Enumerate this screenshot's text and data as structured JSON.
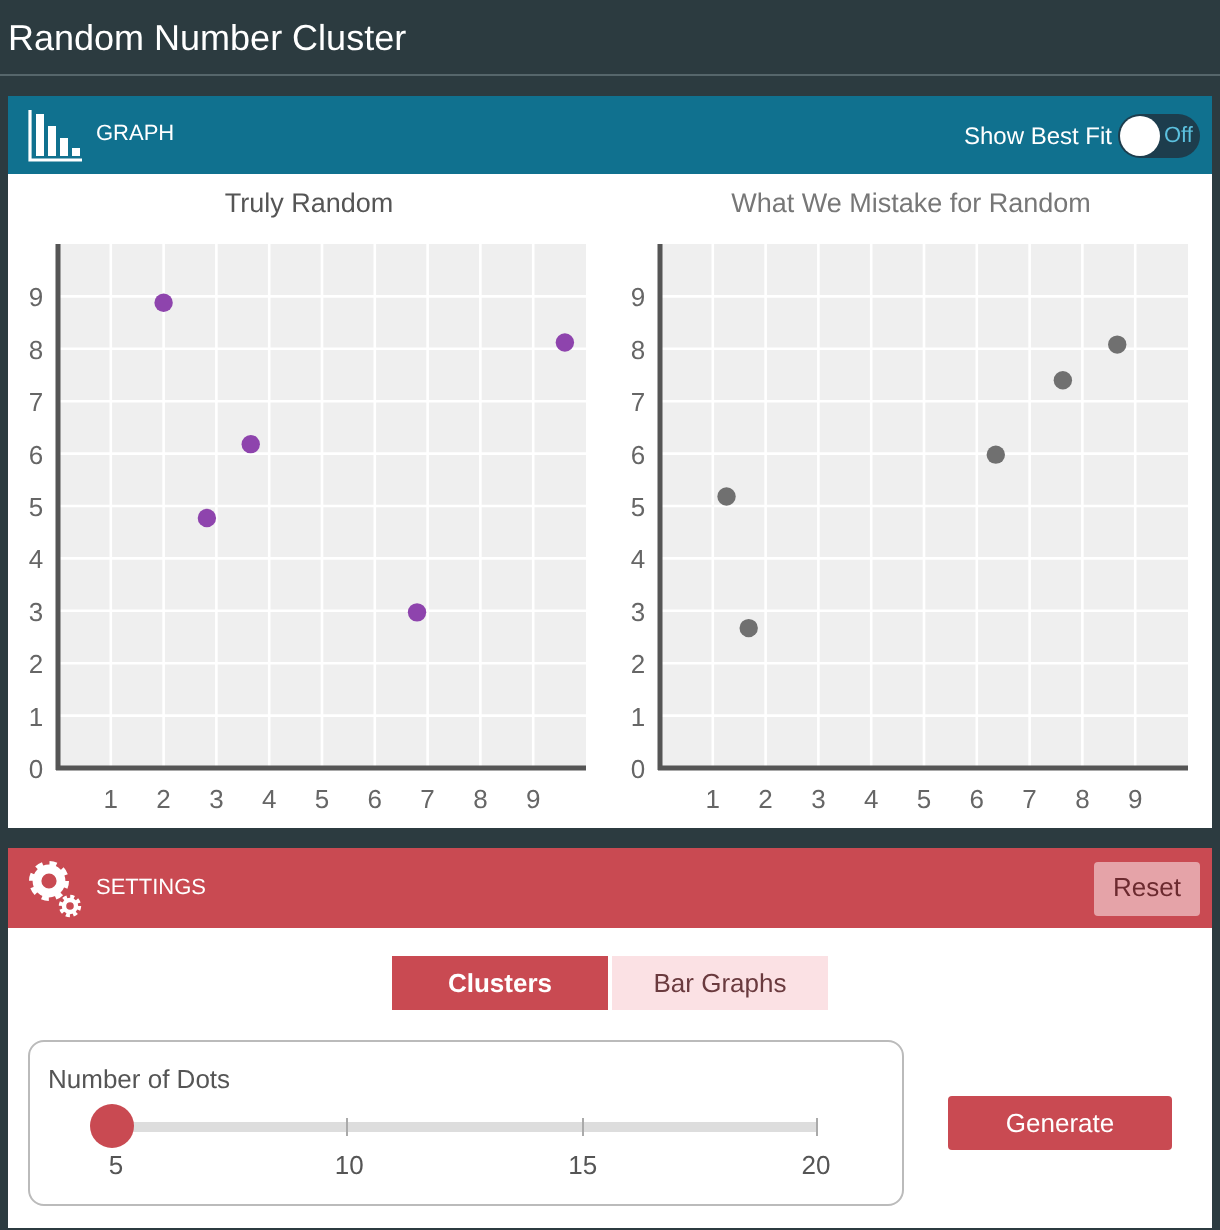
{
  "window": {
    "title": "Random Number Cluster"
  },
  "graph_panel": {
    "title": "GRAPH",
    "best_fit": {
      "label": "Show Best Fit",
      "on": false,
      "state_text": "Off"
    },
    "charts": [
      {
        "chart_data": {
          "type": "scatter",
          "title": "Truly Random",
          "x": [
            2.0,
            2.82,
            3.65,
            6.8,
            9.6
          ],
          "series": [
            {
              "color": "#8e44ad",
              "values": [
                8.88,
                4.77,
                6.18,
                2.97,
                8.12
              ]
            }
          ],
          "xlim": [
            0,
            10
          ],
          "ylim": [
            0,
            10
          ],
          "xticks": [
            1,
            2,
            3,
            4,
            5,
            6,
            7,
            8,
            9
          ],
          "yticks": [
            0,
            1,
            2,
            3,
            4,
            5,
            6,
            7,
            8,
            9
          ],
          "grid": true
        }
      },
      {
        "chart_data": {
          "type": "scatter",
          "title": "What We Mistake for Random",
          "x": [
            1.26,
            1.68,
            6.36,
            7.63,
            8.66
          ],
          "series": [
            {
              "color": "#707070",
              "values": [
                5.18,
                2.67,
                5.98,
                7.4,
                8.08
              ]
            }
          ],
          "xlim": [
            0,
            10
          ],
          "ylim": [
            0,
            10
          ],
          "xticks": [
            1,
            2,
            3,
            4,
            5,
            6,
            7,
            8,
            9
          ],
          "yticks": [
            0,
            1,
            2,
            3,
            4,
            5,
            6,
            7,
            8,
            9
          ],
          "grid": true
        }
      }
    ]
  },
  "settings_panel": {
    "title": "SETTINGS",
    "reset_button": "Reset",
    "tabs": [
      {
        "label": "Clusters",
        "selected": true
      },
      {
        "label": "Bar Graphs",
        "selected": false
      }
    ],
    "slider": {
      "label": "Number of Dots",
      "level": 0,
      "ticks": [
        {
          "label": "5"
        },
        {
          "label": "10"
        },
        {
          "label": "15"
        },
        {
          "label": "20"
        }
      ]
    },
    "generate_button": "Generate"
  }
}
